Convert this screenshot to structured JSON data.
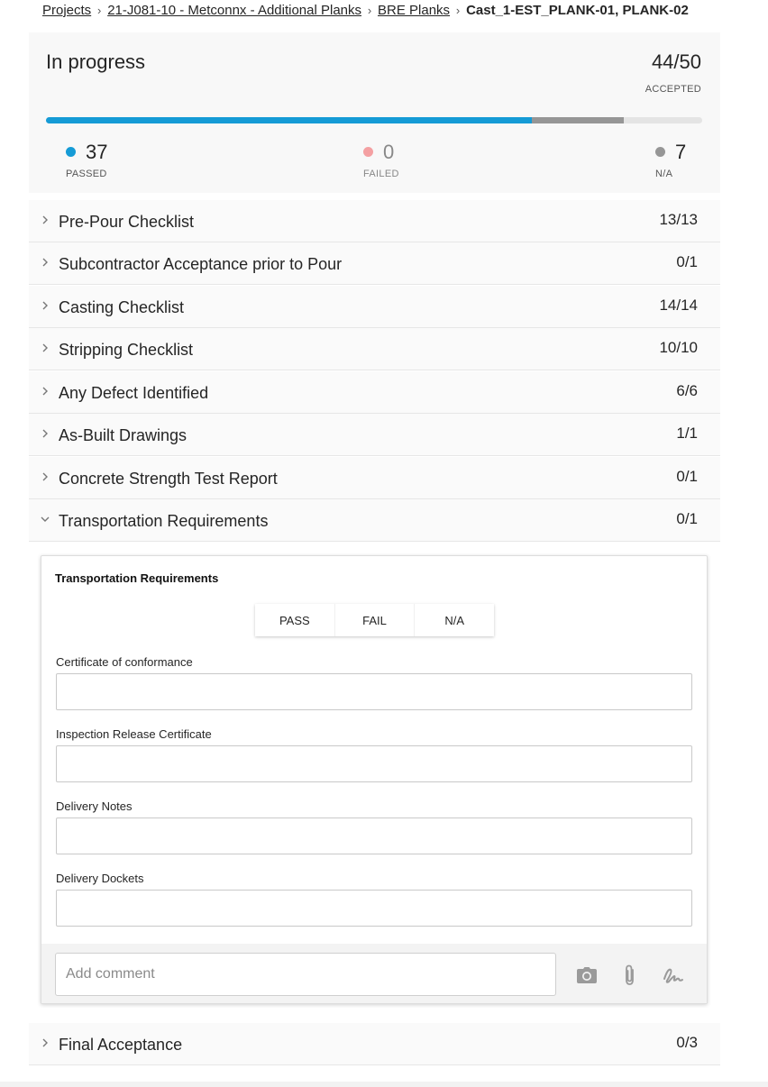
{
  "breadcrumb": {
    "items": [
      "Projects",
      "21-J081-10 - Metconnx - Additional Planks",
      "BRE Planks"
    ],
    "current": "Cast_1-EST_PLANK-01, PLANK-02",
    "separator": ">"
  },
  "summary": {
    "status": "In progress",
    "accepted": "44/50",
    "accepted_label": "ACCEPTED",
    "progress": {
      "passed": 37,
      "failed": 0,
      "na": 7,
      "total": 50
    },
    "passed": {
      "value": "37",
      "label": "PASSED",
      "color": "#159bd6"
    },
    "failed": {
      "value": "0",
      "label": "FAILED",
      "color": "#f4a0a2"
    },
    "na": {
      "value": "7",
      "label": "N/A",
      "color": "#969696"
    }
  },
  "sections": [
    {
      "title": "Pre-Pour Checklist",
      "count": "13/13",
      "expanded": false
    },
    {
      "title": "Subcontractor Acceptance prior to Pour",
      "count": "0/1",
      "expanded": false
    },
    {
      "title": "Casting Checklist",
      "count": "14/14",
      "expanded": false
    },
    {
      "title": "Stripping Checklist",
      "count": "10/10",
      "expanded": false
    },
    {
      "title": "Any Defect Identified",
      "count": "6/6",
      "expanded": false
    },
    {
      "title": "As-Built Drawings",
      "count": "1/1",
      "expanded": false
    },
    {
      "title": "Concrete Strength Test Report",
      "count": "0/1",
      "expanded": false
    },
    {
      "title": "Transportation Requirements",
      "count": "0/1",
      "expanded": true
    },
    {
      "title": "Final Acceptance",
      "count": "0/3",
      "expanded": false
    }
  ],
  "panel": {
    "title": "Transportation Requirements",
    "buttons": {
      "pass": "PASS",
      "fail": "FAIL",
      "na": "N/A"
    },
    "fields": [
      {
        "label": "Certificate of conformance",
        "value": ""
      },
      {
        "label": "Inspection Release Certificate",
        "value": ""
      },
      {
        "label": "Delivery Notes",
        "value": ""
      },
      {
        "label": "Delivery Dockets",
        "value": ""
      }
    ],
    "comment": {
      "placeholder": "Add comment",
      "value": ""
    },
    "icons": [
      "camera-icon",
      "paperclip-icon",
      "signature-icon"
    ]
  },
  "colors": {
    "accent": "#159bd6",
    "failed": "#f4a0a2",
    "na": "#969696"
  }
}
